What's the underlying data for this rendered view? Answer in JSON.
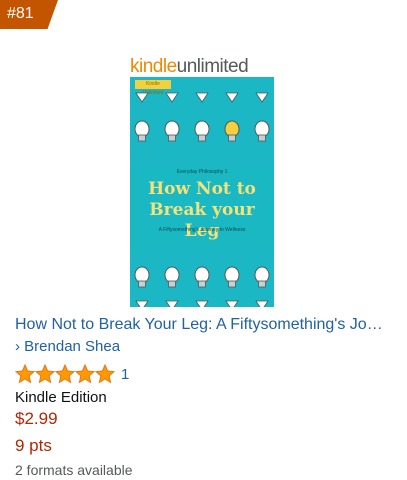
{
  "badge": {
    "rank": "#81"
  },
  "cover": {
    "logo_part1": "kindle",
    "logo_part2": "unlimited",
    "tag": "Kindle Unlimited",
    "series": "Everyday Philosophy 1",
    "title_line1": "How Not to",
    "title_line2": "Break your Leg",
    "subtitle": "A Fiftysomething's Journey to Wellness"
  },
  "product": {
    "title": "How Not to Break Your Leg: A Fiftysomething's Journey to Wellness",
    "author_prefix": "›",
    "author": "Brendan Shea",
    "rating_stars": 5,
    "rating_count": "1",
    "format": "Kindle Edition",
    "price": "$2.99",
    "points": "9 pts",
    "formats_available": "2 formats available"
  },
  "colors": {
    "badge": "#c45500",
    "link": "#2162a1",
    "price": "#b12704",
    "star": "#ff9900",
    "cover_teal": "#1bb7c4",
    "cover_title": "#f6e27a"
  },
  "icons": {
    "star": "star-icon",
    "bulb": "light-bulb-icon"
  }
}
